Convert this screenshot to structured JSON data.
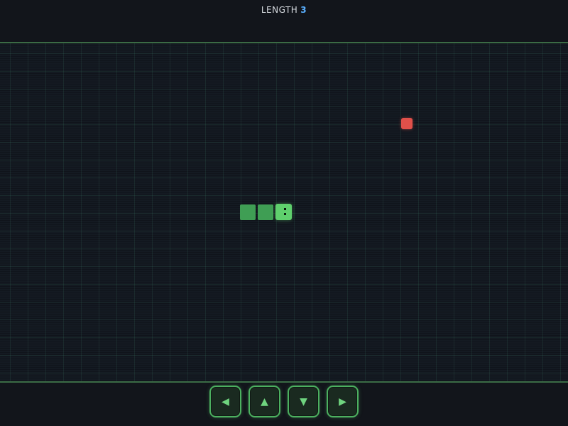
{
  "hud": {
    "score_label": "LENGTH",
    "score_value": "3"
  },
  "board": {
    "snake": {
      "length": 3,
      "direction": "right"
    },
    "food": {
      "color": "#e0504a"
    }
  },
  "controls": {
    "left_glyph": "◀",
    "up_glyph": "▲",
    "down_glyph": "▼",
    "right_glyph": "▶"
  },
  "colors": {
    "accent": "#4cb060",
    "snake_head": "#5fd06d",
    "snake_body": "#3f9e54",
    "score_value": "#5ab0ff"
  },
  "icons": [
    "arrow-left-icon",
    "arrow-up-icon",
    "arrow-down-icon",
    "arrow-right-icon"
  ]
}
